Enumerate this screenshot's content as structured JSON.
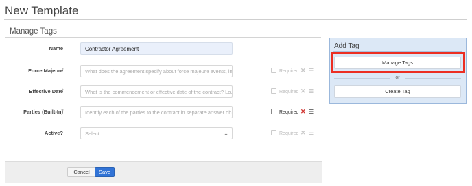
{
  "page": {
    "title": "New Template"
  },
  "section": {
    "title": "Manage Tags"
  },
  "form": {
    "rows": [
      {
        "label": "Name",
        "value": "Contractor Agreement",
        "placeholder": "",
        "magic": false
      },
      {
        "label": "Force Majeure",
        "value": "",
        "placeholder": "What does the agreement specify about force majeure events, in...",
        "magic": true,
        "required_label": "Required",
        "active": false
      },
      {
        "label": "Effective Date",
        "value": "",
        "placeholder": "What is the commencement or effective date of the contract? Lo...",
        "magic": true,
        "required_label": "Required",
        "active": false
      },
      {
        "label": "Parties (Built-In)",
        "value": "",
        "placeholder": "Identify each of the parties to the contract in separate answer ob...",
        "magic": true,
        "required_label": "Required",
        "active": true
      },
      {
        "label": "Active?",
        "value": "",
        "placeholder": "Select...",
        "magic": false,
        "required_label": "Required",
        "active": false
      }
    ]
  },
  "footer": {
    "cancel_label": "Cancel",
    "save_label": "Save"
  },
  "add_tag_panel": {
    "title": "Add Tag",
    "manage_tags_label": "Manage Tags",
    "or_label": "or",
    "create_tag_label": "Create Tag",
    "highlight_color": "#ec2e22"
  },
  "colors": {
    "accent": "#3173d6",
    "danger": "#d0312d",
    "panel_bg": "#dce8f6"
  },
  "icons": {
    "magic": "sparkle-icon",
    "remove": "close-icon",
    "details": "list-icon",
    "select": "chevron-down-icon"
  }
}
